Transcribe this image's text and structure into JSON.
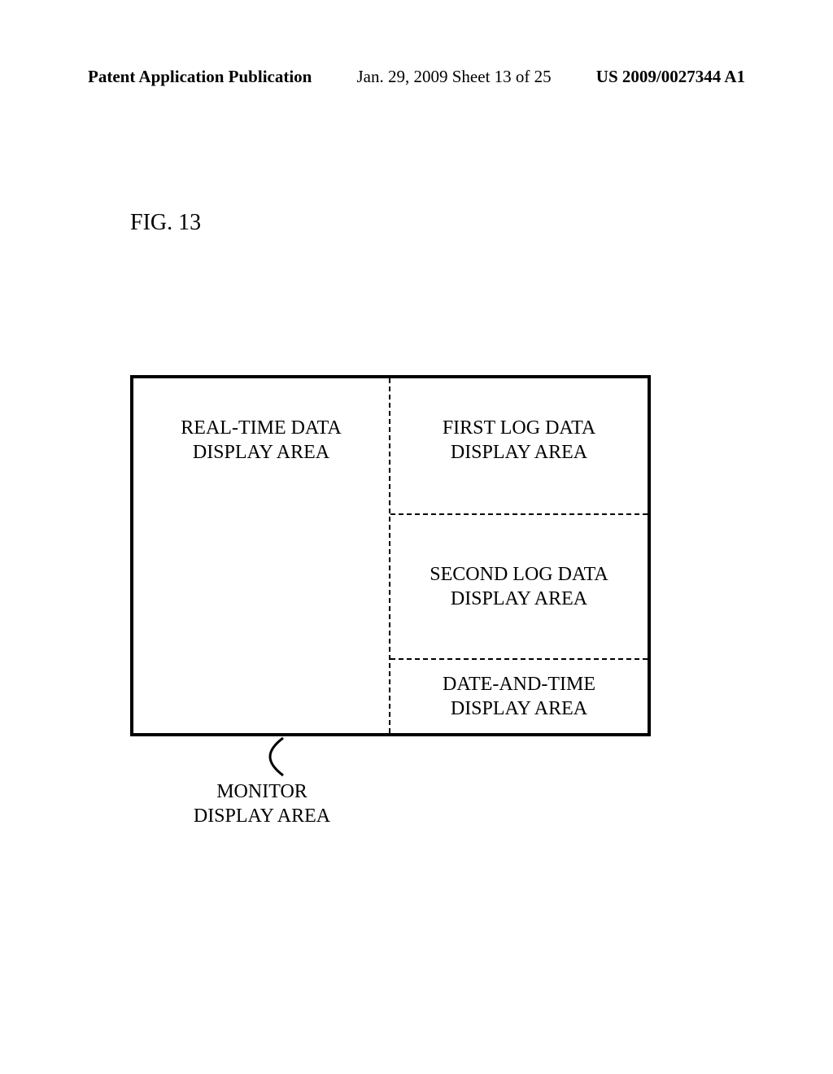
{
  "header": {
    "left": "Patent Application Publication",
    "center": "Jan. 29, 2009   Sheet 13 of 25",
    "right": "US 2009/0027344 A1"
  },
  "figure": {
    "label": "FIG. 13",
    "areas": {
      "real_time_line1": "REAL-TIME DATA",
      "real_time_line2": "DISPLAY AREA",
      "first_log_line1": "FIRST LOG DATA",
      "first_log_line2": "DISPLAY AREA",
      "second_log_line1": "SECOND LOG DATA",
      "second_log_line2": "DISPLAY AREA",
      "date_time_line1": "DATE-AND-TIME",
      "date_time_line2": "DISPLAY AREA"
    },
    "monitor_line1": "MONITOR",
    "monitor_line2": "DISPLAY AREA"
  }
}
